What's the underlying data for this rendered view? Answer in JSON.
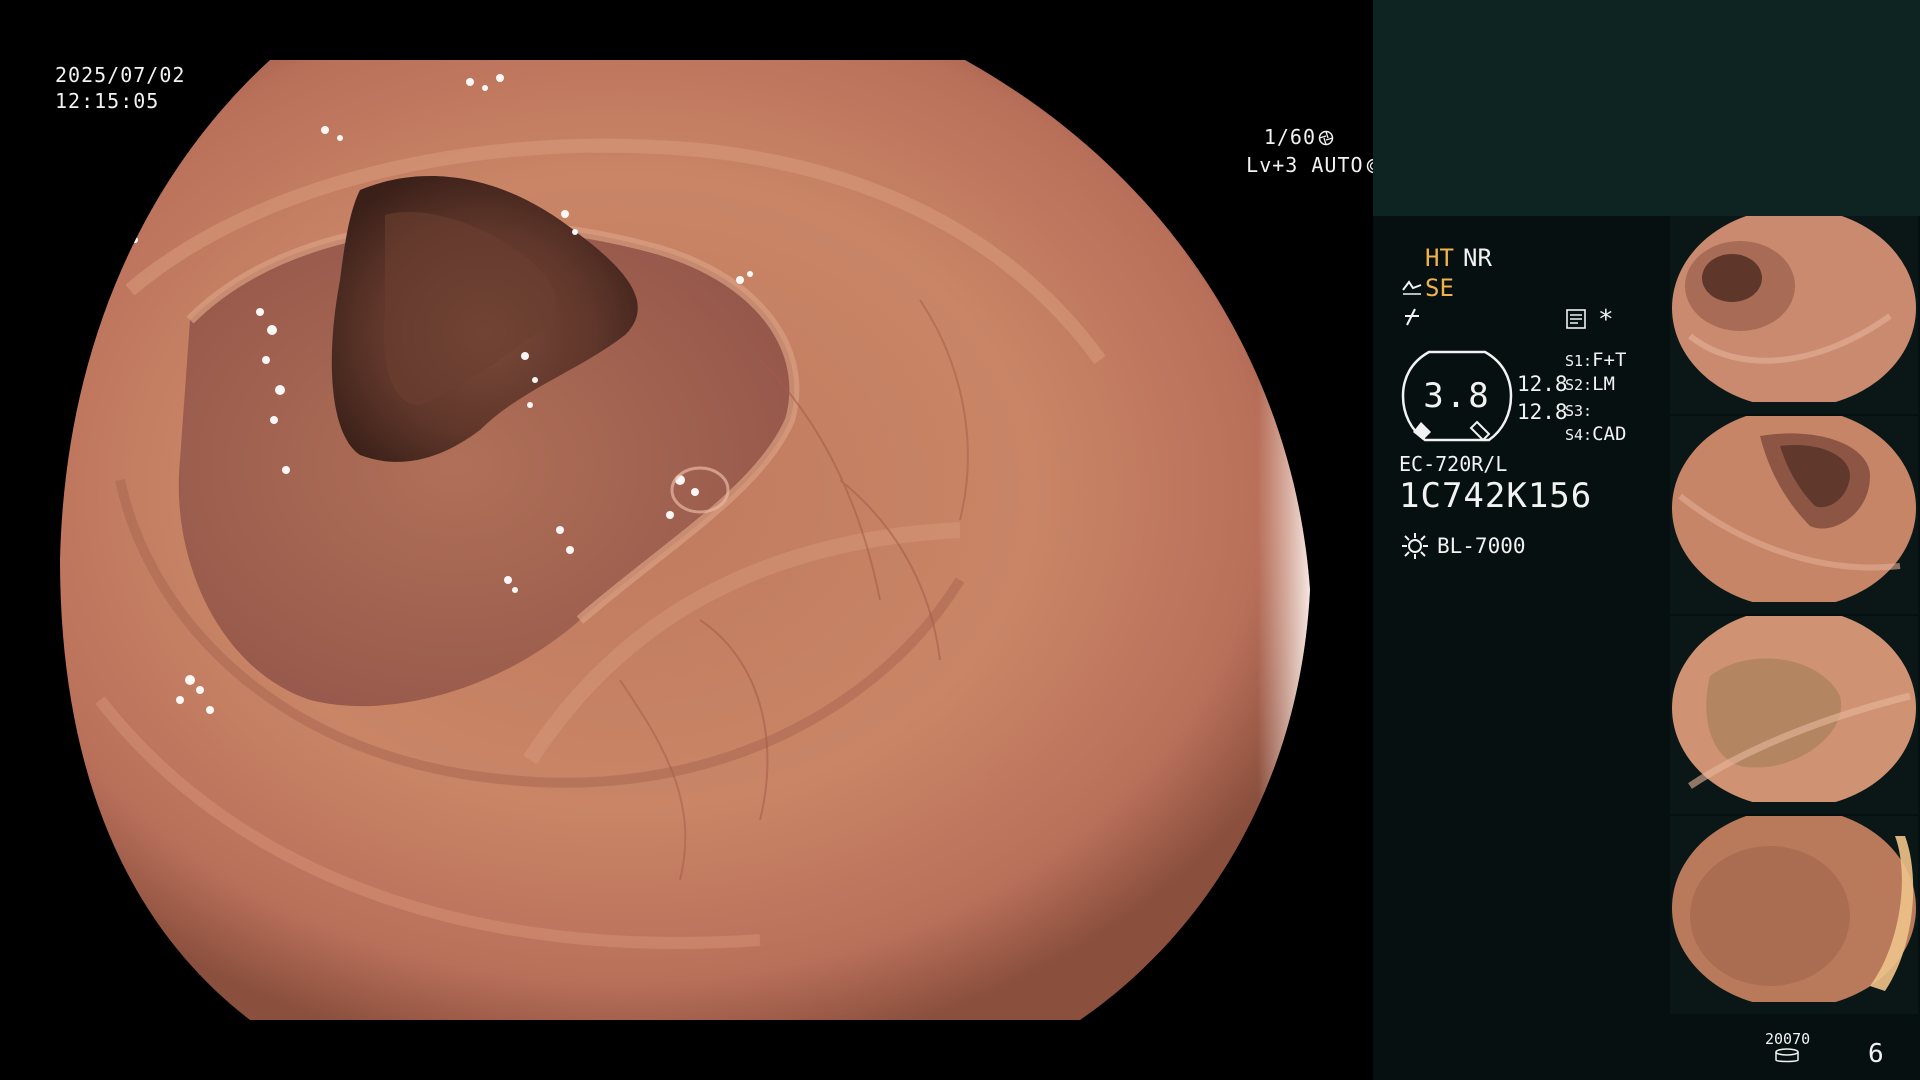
{
  "osd": {
    "date": "2025/07/02",
    "time": "12:15:05",
    "shutter": "1/60",
    "level": "Lv+3 AUTO",
    "shutter_icon": "aperture-icon",
    "level_icon": "iris-icon"
  },
  "panel": {
    "modes": {
      "ht": "HT",
      "nr": "NR",
      "se": "SE",
      "se_icon": "scope-angle-icon",
      "flash_icon": "freeze-icon",
      "memo_icon": "memo-icon",
      "star": "*"
    },
    "zoom": {
      "value": "3.8",
      "a": "12.8",
      "b": "12.8"
    },
    "switches": [
      {
        "key": "S1:",
        "value": "F+T"
      },
      {
        "key": "S2:",
        "value": "LM"
      },
      {
        "key": "S3:",
        "value": ""
      },
      {
        "key": "S4:",
        "value": "CAD"
      }
    ],
    "scope_model": "EC-720R/L",
    "scope_serial": "1C742K156",
    "light_icon": "light-source-icon",
    "light_source": "BL-7000",
    "storage_count": "20070",
    "storage_icon": "storage-icon",
    "image_count": "6"
  },
  "thumbnails": [
    {
      "name": "captured-image-1"
    },
    {
      "name": "captured-image-2"
    },
    {
      "name": "captured-image-3"
    },
    {
      "name": "captured-image-4"
    }
  ],
  "colors": {
    "panel_bg": "#061010",
    "panel_top_bg": "#0d2423",
    "accent": "#f0b24a",
    "mucosa": "#c98566"
  }
}
